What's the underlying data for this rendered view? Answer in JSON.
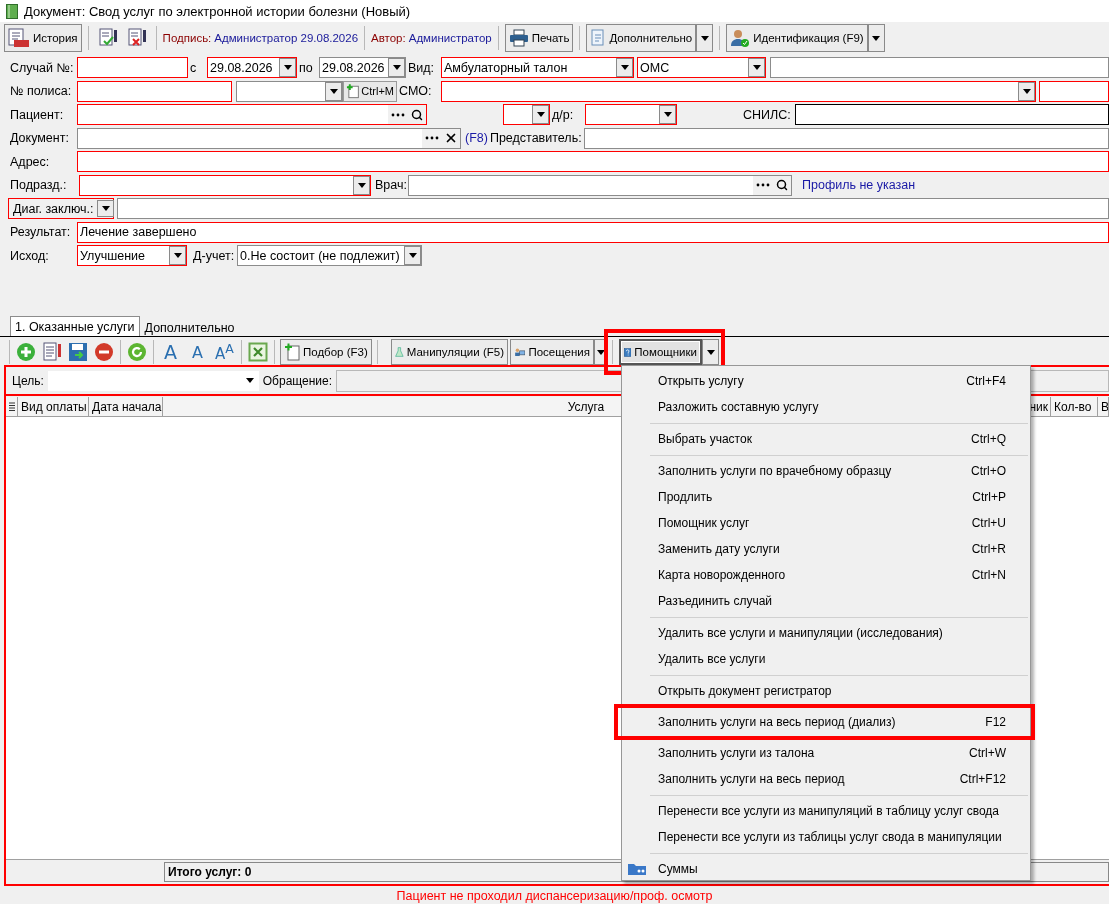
{
  "window": {
    "title": "Документ: Свод услуг по электронной истории болезни (Новый)"
  },
  "toolbar": {
    "history": "История",
    "signature": {
      "label": "Подпись:",
      "value": "Администратор 29.08.2026"
    },
    "author": {
      "label": "Автор:",
      "value": "Администратор"
    },
    "print": "Печать",
    "more": "Дополнительно",
    "identify": "Идентификация (F9)"
  },
  "form": {
    "rows": [
      {
        "items": [
          {
            "kind": "label",
            "text": "Случай №:"
          },
          {
            "kind": "text",
            "required": true
          },
          {
            "kind": "label",
            "text": "с"
          },
          {
            "kind": "combo",
            "value": "29.08.2026",
            "required": true
          },
          {
            "kind": "label",
            "text": "по"
          },
          {
            "kind": "combo",
            "value": "29.08.2026",
            "required": false
          },
          {
            "kind": "label",
            "text": "Вид:"
          },
          {
            "kind": "combo",
            "value": "Амбулаторный талон",
            "required": true
          },
          {
            "kind": "combo",
            "value": "ОМС",
            "required": true
          },
          {
            "kind": "text",
            "required": false
          }
        ]
      },
      {
        "items": [
          {
            "kind": "label",
            "text": "№ полиса:"
          },
          {
            "kind": "text",
            "required": true
          },
          {
            "kind": "combo",
            "required": false
          },
          {
            "kind": "button",
            "text": "Ctrl+M"
          },
          {
            "kind": "label",
            "text": "СМО:"
          },
          {
            "kind": "combo",
            "required": true
          },
          {
            "kind": "text",
            "required": true
          }
        ]
      },
      {
        "items": [
          {
            "kind": "label",
            "text": "Пациент:"
          },
          {
            "kind": "lookup",
            "required": true
          },
          {
            "kind": "combo",
            "required": true
          },
          {
            "kind": "label",
            "text": "д/р:"
          },
          {
            "kind": "combo",
            "required": true
          },
          {
            "kind": "label",
            "text": "СНИЛС:"
          },
          {
            "kind": "text",
            "required": false,
            "strong": true
          }
        ]
      },
      {
        "items": [
          {
            "kind": "label",
            "text": "Документ:"
          },
          {
            "kind": "clear_lookup",
            "required": false
          },
          {
            "kind": "link",
            "text": "(F8)"
          },
          {
            "kind": "label",
            "text": "Представитель:"
          },
          {
            "kind": "text",
            "required": false
          }
        ]
      },
      {
        "items": [
          {
            "kind": "label",
            "text": "Адрес:"
          },
          {
            "kind": "text",
            "required": true
          }
        ]
      },
      {
        "items": [
          {
            "kind": "label",
            "text": "Подразд.:"
          },
          {
            "kind": "combo",
            "required": true
          },
          {
            "kind": "label",
            "text": "Врач:"
          },
          {
            "kind": "lookup",
            "required": false
          },
          {
            "kind": "link",
            "text": "Профиль не указан"
          }
        ]
      },
      {
        "items": [
          {
            "kind": "label_combo",
            "text": "Диаг. заключ.:",
            "required": true
          },
          {
            "kind": "text",
            "required": false
          }
        ]
      },
      {
        "items": [
          {
            "kind": "label",
            "text": "Результат:"
          },
          {
            "kind": "text",
            "value": "Лечение завершено",
            "required": true
          }
        ]
      },
      {
        "items": [
          {
            "kind": "label",
            "text": "Исход:"
          },
          {
            "kind": "combo",
            "value": "Улучшение",
            "required": true
          },
          {
            "kind": "label",
            "text": "Д-учет:"
          },
          {
            "kind": "combo",
            "value": "0.Не состоит (не подлежит)",
            "required": false
          }
        ]
      }
    ]
  },
  "tabs": [
    {
      "label": "1. Оказанные услуги",
      "selected": true
    },
    {
      "label": "Дополнительно",
      "selected": false
    }
  ],
  "services_toolbar": {
    "font_tools": [
      {
        "kind": "grow",
        "glyph": "A"
      },
      {
        "kind": "shrink",
        "glyph": "A"
      },
      {
        "kind": "reset",
        "glyph": "A$^{A}$"
      }
    ],
    "buttons": [
      {
        "kind": "button",
        "label": "Подбор (F3)",
        "pressed": false,
        "highlighted": false
      },
      {
        "kind": "button",
        "label": "Манипуляции (F5)",
        "pressed": false,
        "highlighted": false
      },
      {
        "kind": "split",
        "label": "Посещения",
        "pressed": false,
        "highlighted": false
      },
      {
        "kind": "split",
        "label": "Помощники",
        "pressed": true,
        "highlighted": true
      }
    ]
  },
  "filter": {
    "goal_label": "Цель:",
    "appeal_label": "Обращение:"
  },
  "table": {
    "columns": [
      "Вид оплаты",
      "Дата начала",
      "Услуга",
      "ник",
      "Кол-во",
      "В"
    ],
    "total": "Итого услуг: 0"
  },
  "menu": {
    "items": [
      {
        "kind": "item",
        "label": "Открыть услугу",
        "shortcut": "Ctrl+F4",
        "highlighted": false
      },
      {
        "kind": "item",
        "label": "Разложить составную услугу",
        "highlighted": false
      },
      {
        "kind": "separator"
      },
      {
        "kind": "item",
        "label": "Выбрать участок",
        "shortcut": "Ctrl+Q",
        "highlighted": false
      },
      {
        "kind": "separator"
      },
      {
        "kind": "item",
        "label": "Заполнить услуги по врачебному образцу",
        "shortcut": "Ctrl+O",
        "highlighted": false
      },
      {
        "kind": "item",
        "label": "Продлить",
        "shortcut": "Ctrl+P",
        "highlighted": false
      },
      {
        "kind": "item",
        "label": "Помощник услуг",
        "shortcut": "Ctrl+U",
        "highlighted": false
      },
      {
        "kind": "item",
        "label": "Заменить дату услуги",
        "shortcut": "Ctrl+R",
        "highlighted": false
      },
      {
        "kind": "item",
        "label": "Карта новорожденного",
        "shortcut": "Ctrl+N",
        "highlighted": false
      },
      {
        "kind": "item",
        "label": "Разъединить случай",
        "highlighted": false
      },
      {
        "kind": "separator"
      },
      {
        "kind": "item",
        "label": "Удалить все услуги и манипуляции (исследования)",
        "highlighted": false
      },
      {
        "kind": "item",
        "label": "Удалить все услуги",
        "highlighted": false
      },
      {
        "kind": "separator"
      },
      {
        "kind": "item",
        "label": "Открыть документ регистратор",
        "highlighted": false
      },
      {
        "kind": "separator"
      },
      {
        "kind": "item",
        "label": "Заполнить услуги на весь период (диализ)",
        "shortcut": "F12",
        "highlighted": true
      },
      {
        "kind": "item",
        "label": "Заполнить услуги из талона",
        "shortcut": "Ctrl+W",
        "highlighted": false
      },
      {
        "kind": "item",
        "label": "Заполнить услуги на весь период",
        "shortcut": "Ctrl+F12",
        "highlighted": false
      },
      {
        "kind": "separator"
      },
      {
        "kind": "item",
        "label": "Перенести все услуги из манипуляций в таблицу услуг свода",
        "highlighted": false
      },
      {
        "kind": "item",
        "label": "Перенести все услуги из таблицы услуг свода в манипуляции",
        "highlighted": false
      },
      {
        "kind": "separator"
      },
      {
        "kind": "icon_item",
        "label": "Суммы",
        "highlighted": false
      }
    ]
  },
  "warning": "Пациент не проходил диспансеризацию/проф. осмотр"
}
